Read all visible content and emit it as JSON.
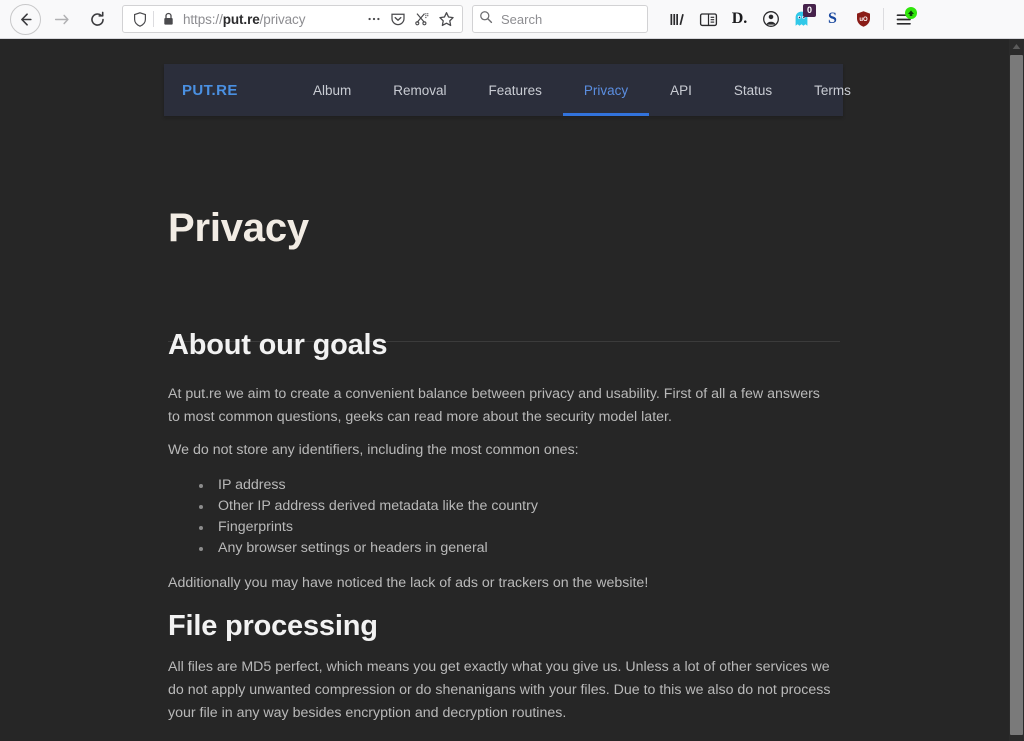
{
  "browser": {
    "back_label": "Back",
    "forward_label": "Forward",
    "reload_label": "Reload",
    "url": {
      "scheme": "https://",
      "host": "put.re",
      "path": "/privacy",
      "full": "https://put.re/privacy"
    },
    "search": {
      "placeholder": "Search"
    },
    "toolbar_icons": [
      {
        "name": "library-icon",
        "glyph": ""
      },
      {
        "name": "reader-view-icon",
        "glyph": ""
      },
      {
        "name": "dashlane-icon",
        "glyph": "D."
      },
      {
        "name": "account-icon",
        "glyph": ""
      },
      {
        "name": "ghostery-icon",
        "glyph": "",
        "badge": "0"
      },
      {
        "name": "stylus-icon",
        "glyph": "S"
      },
      {
        "name": "ublock-origin-icon",
        "glyph": "uO"
      },
      {
        "name": "app-menu-icon",
        "glyph": ""
      }
    ],
    "url_actions": [
      {
        "name": "page-actions-icon",
        "glyph": "•••"
      },
      {
        "name": "pocket-icon",
        "glyph": ""
      },
      {
        "name": "screenshot-icon",
        "glyph": ""
      },
      {
        "name": "bookmark-star-icon",
        "glyph": "☆"
      }
    ]
  },
  "site": {
    "logo": "PUT.RE",
    "nav": [
      {
        "label": "Album",
        "active": false
      },
      {
        "label": "Removal",
        "active": false
      },
      {
        "label": "Features",
        "active": false
      },
      {
        "label": "Privacy",
        "active": true
      },
      {
        "label": "API",
        "active": false
      },
      {
        "label": "Status",
        "active": false
      },
      {
        "label": "Terms",
        "active": false
      }
    ],
    "accent_color": "#3273dc",
    "navbar_bg": "#2b2e3b",
    "page_bg": "#262626"
  },
  "page": {
    "title": "Privacy",
    "sections": [
      {
        "heading": "About our goals",
        "para_1": "At put.re we aim to create a convenient balance between privacy and usability. First of all a few answers to most common questions, geeks can read more about the security model later.",
        "para_2": "We do not store any identifiers, including the most common ones:",
        "list": [
          "IP address",
          "Other IP address derived metadata like the country",
          "Fingerprints",
          "Any browser settings or headers in general"
        ],
        "para_3": "Additionally you may have noticed the lack of ads or trackers on the website!"
      },
      {
        "heading": "File processing",
        "para_4": "All files are MD5 perfect, which means you get exactly what you give us. Unless a lot of other services we do not apply unwanted compression or do shenanigans with your files. Due to this we also do not process your file in any way besides encryption and decryption routines."
      }
    ]
  }
}
